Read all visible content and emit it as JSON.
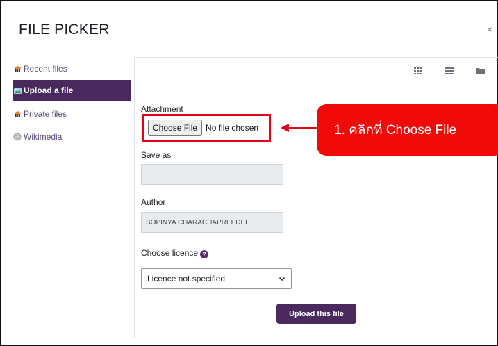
{
  "dialog": {
    "title": "FILE PICKER",
    "close_glyph": "×"
  },
  "sidebar": {
    "items": [
      {
        "label": "Recent files",
        "icon": "moodle-hat-icon",
        "active": false
      },
      {
        "label": "Upload a file",
        "icon": "upload-icon",
        "active": true
      },
      {
        "label": "Private files",
        "icon": "moodle-hat-icon",
        "active": false
      },
      {
        "label": "Wikimedia",
        "icon": "wikimedia-icon",
        "active": false
      }
    ]
  },
  "toolbar": {
    "icons": [
      "grid-view-icon",
      "list-view-icon",
      "folder-view-icon"
    ]
  },
  "form": {
    "attachment_label": "Attachment",
    "choose_button": "Choose File",
    "no_file": "No file chosen",
    "save_as_label": "Save as",
    "save_as_value": "",
    "author_label": "Author",
    "author_value": "SOPINYA CHARACHAPREEDEE",
    "licence_label": "Choose licence",
    "licence_value": "Licence not specified",
    "upload_button": "Upload this file"
  },
  "annotation": {
    "callout_text": "1. คลิกที่ Choose File",
    "color": "#f00a0a"
  },
  "colors": {
    "accent": "#4a2a5e",
    "annotation_red": "#e3001b"
  }
}
